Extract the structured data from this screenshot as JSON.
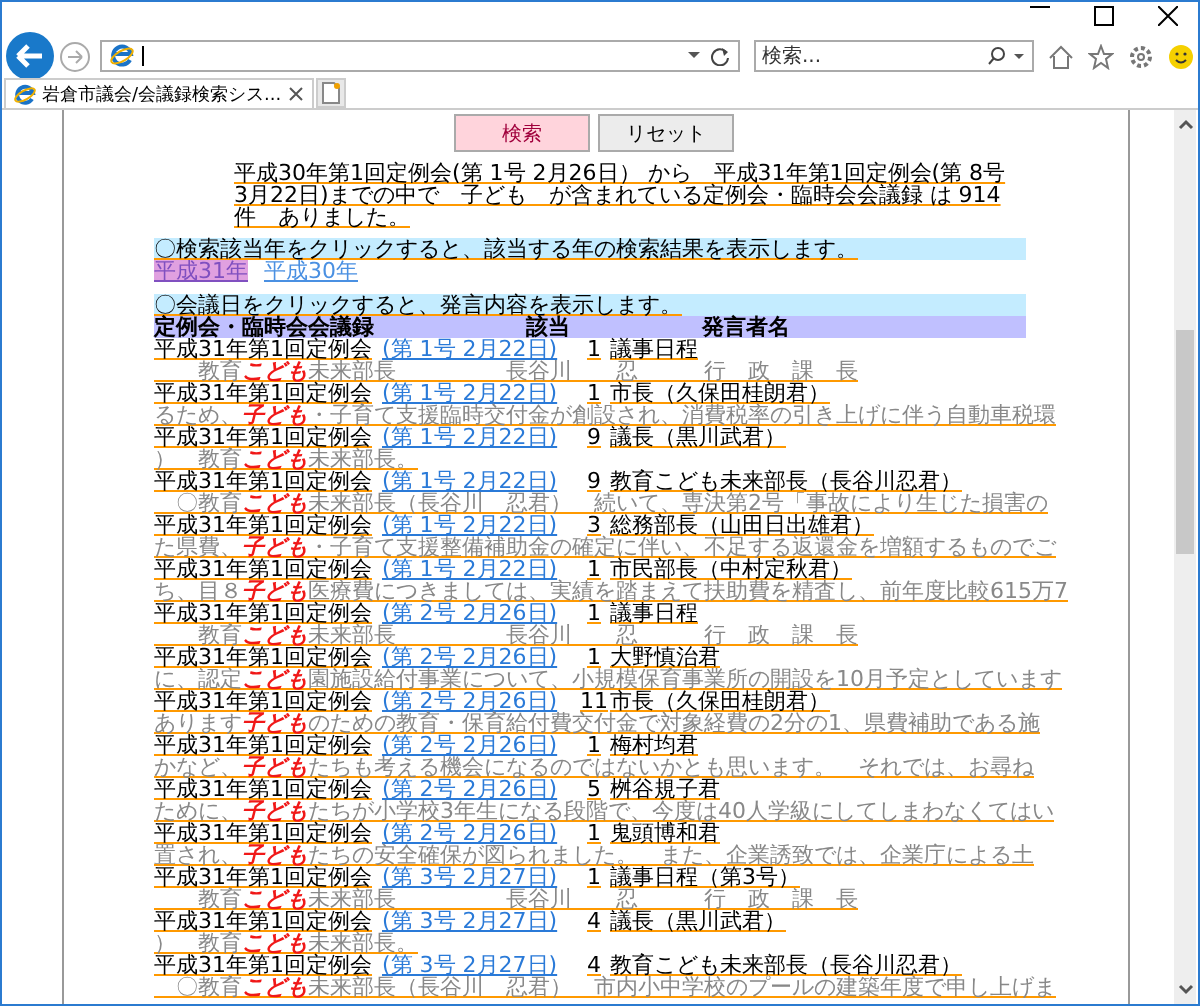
{
  "browser": {
    "tab_title": "岩倉市議会/会議録検索シス...",
    "search": {
      "placeholder": "検索..."
    }
  },
  "form_buttons": [
    {
      "label": "検索",
      "kind": "primary"
    },
    {
      "label": "リセット",
      "kind": "secondary"
    }
  ],
  "summary": "平成30年第1回定例会(第 1号 2月26日） から　平成31年第1回定例会(第 8号 3月22日)までの中で　子ども　が含まれている定例会・臨時会会議録 は 914 件　ありました。",
  "year_notice": "〇検索該当年をクリックすると、該当する年の検索結果を表示します。",
  "years": [
    {
      "label": "平成31年",
      "selected": true
    },
    {
      "label": "平成30年",
      "selected": false
    }
  ],
  "date_notice": "〇会議日をクリックすると、発言内容を表示します。",
  "table": {
    "columns": [
      "定例会・臨時会会議録",
      "該当",
      "発言者名"
    ],
    "rows": [
      {
        "session": "平成31年第1回定例会",
        "date": "(第 1号 2月22日)",
        "count": "1",
        "speaker": "議事日程",
        "snippet": {
          "before": "　　教育",
          "keyword": "こども",
          "after": "未来部長　　　　　長谷川　　忍　　　行　政　課　長"
        }
      },
      {
        "session": "平成31年第1回定例会",
        "date": "(第 1号 2月22日)",
        "count": "1",
        "speaker": "市長（久保田桂朗君）",
        "snippet": {
          "before": "るため、",
          "keyword": "子ども",
          "after": "・子育て支援臨時交付金が創設され、消費税率の引き上げに伴う自動車税環"
        }
      },
      {
        "session": "平成31年第1回定例会",
        "date": "(第 1号 2月22日)",
        "count": "9",
        "speaker": "議長（黒川武君）",
        "snippet": {
          "before": "）　教育",
          "keyword": "こども",
          "after": "未来部長。"
        }
      },
      {
        "session": "平成31年第1回定例会",
        "date": "(第 1号 2月22日)",
        "count": "9",
        "speaker": "教育こども未来部長（長谷川忍君）",
        "snippet": {
          "before": "　〇教育",
          "keyword": "こども",
          "after": "未来部長（長谷川　忍君）　続いて、専決第2号「事故により生じた損害の"
        }
      },
      {
        "session": "平成31年第1回定例会",
        "date": "(第 1号 2月22日)",
        "count": "3",
        "speaker": "総務部長（山田日出雄君）",
        "snippet": {
          "before": "た県費、",
          "keyword": "子ども",
          "after": "・子育て支援整備補助金の確定に伴い、不足する返還金を増額するものでご"
        }
      },
      {
        "session": "平成31年第1回定例会",
        "date": "(第 1号 2月22日)",
        "count": "1",
        "speaker": "市民部長（中村定秋君）",
        "snippet": {
          "before": "ち、目８",
          "keyword": "子ども",
          "after": "医療費につきましては、実績を踏まえて扶助費を精査し、前年度比較615万7"
        }
      },
      {
        "session": "平成31年第1回定例会",
        "date": "(第 2号 2月26日)",
        "count": "1",
        "speaker": "議事日程",
        "snippet": {
          "before": "　　教育",
          "keyword": "こども",
          "after": "未来部長　　　　　長谷川　　忍　　　行　政　課　長"
        }
      },
      {
        "session": "平成31年第1回定例会",
        "date": "(第 2号 2月26日)",
        "count": "1",
        "speaker": "大野慎治君",
        "snippet": {
          "before": "に、認定",
          "keyword": "こども",
          "after": "園施設給付事業について、小規模保育事業所の開設を10月予定としています"
        }
      },
      {
        "session": "平成31年第1回定例会",
        "date": "(第 2号 2月26日)",
        "count": "11",
        "speaker": "市長（久保田桂朗君）",
        "snippet": {
          "before": "あります",
          "keyword": "子ども",
          "after": "のための教育・保育給付費交付金で対象経費の2分の1、県費補助である施"
        }
      },
      {
        "session": "平成31年第1回定例会",
        "date": "(第 2号 2月26日)",
        "count": "1",
        "speaker": "梅村均君",
        "snippet": {
          "before": "かなど、",
          "keyword": "子ども",
          "after": "たちも考える機会になるのではないかとも思います。　それでは、お尋ね"
        }
      },
      {
        "session": "平成31年第1回定例会",
        "date": "(第 2号 2月26日)",
        "count": "5",
        "speaker": "桝谷規子君",
        "snippet": {
          "before": "ために、",
          "keyword": "子ども",
          "after": "たちが小学校3年生になる段階で、今度は40人学級にしてしまわなくてはい"
        }
      },
      {
        "session": "平成31年第1回定例会",
        "date": "(第 2号 2月26日)",
        "count": "1",
        "speaker": "鬼頭博和君",
        "snippet": {
          "before": "置され、",
          "keyword": "子ども",
          "after": "たちの安全確保が図られました。　また、企業誘致では、企業庁による土"
        }
      },
      {
        "session": "平成31年第1回定例会",
        "date": "(第 3号 2月27日)",
        "count": "1",
        "speaker": "議事日程（第3号）",
        "snippet": {
          "before": "　　教育",
          "keyword": "こども",
          "after": "未来部長　　　　　長谷川　　忍　　　行　政　課　長"
        }
      },
      {
        "session": "平成31年第1回定例会",
        "date": "(第 3号 2月27日)",
        "count": "4",
        "speaker": "議長（黒川武君）",
        "snippet": {
          "before": "）　教育",
          "keyword": "こども",
          "after": "未来部長。"
        }
      },
      {
        "session": "平成31年第1回定例会",
        "date": "(第 3号 2月27日)",
        "count": "4",
        "speaker": "教育こども未来部長（長谷川忍君）",
        "snippet": {
          "before": "　〇教育",
          "keyword": "こども",
          "after": "未来部長（長谷川　忍君）　市内小中学校のプールの建築年度で申し上げま"
        }
      }
    ]
  }
}
